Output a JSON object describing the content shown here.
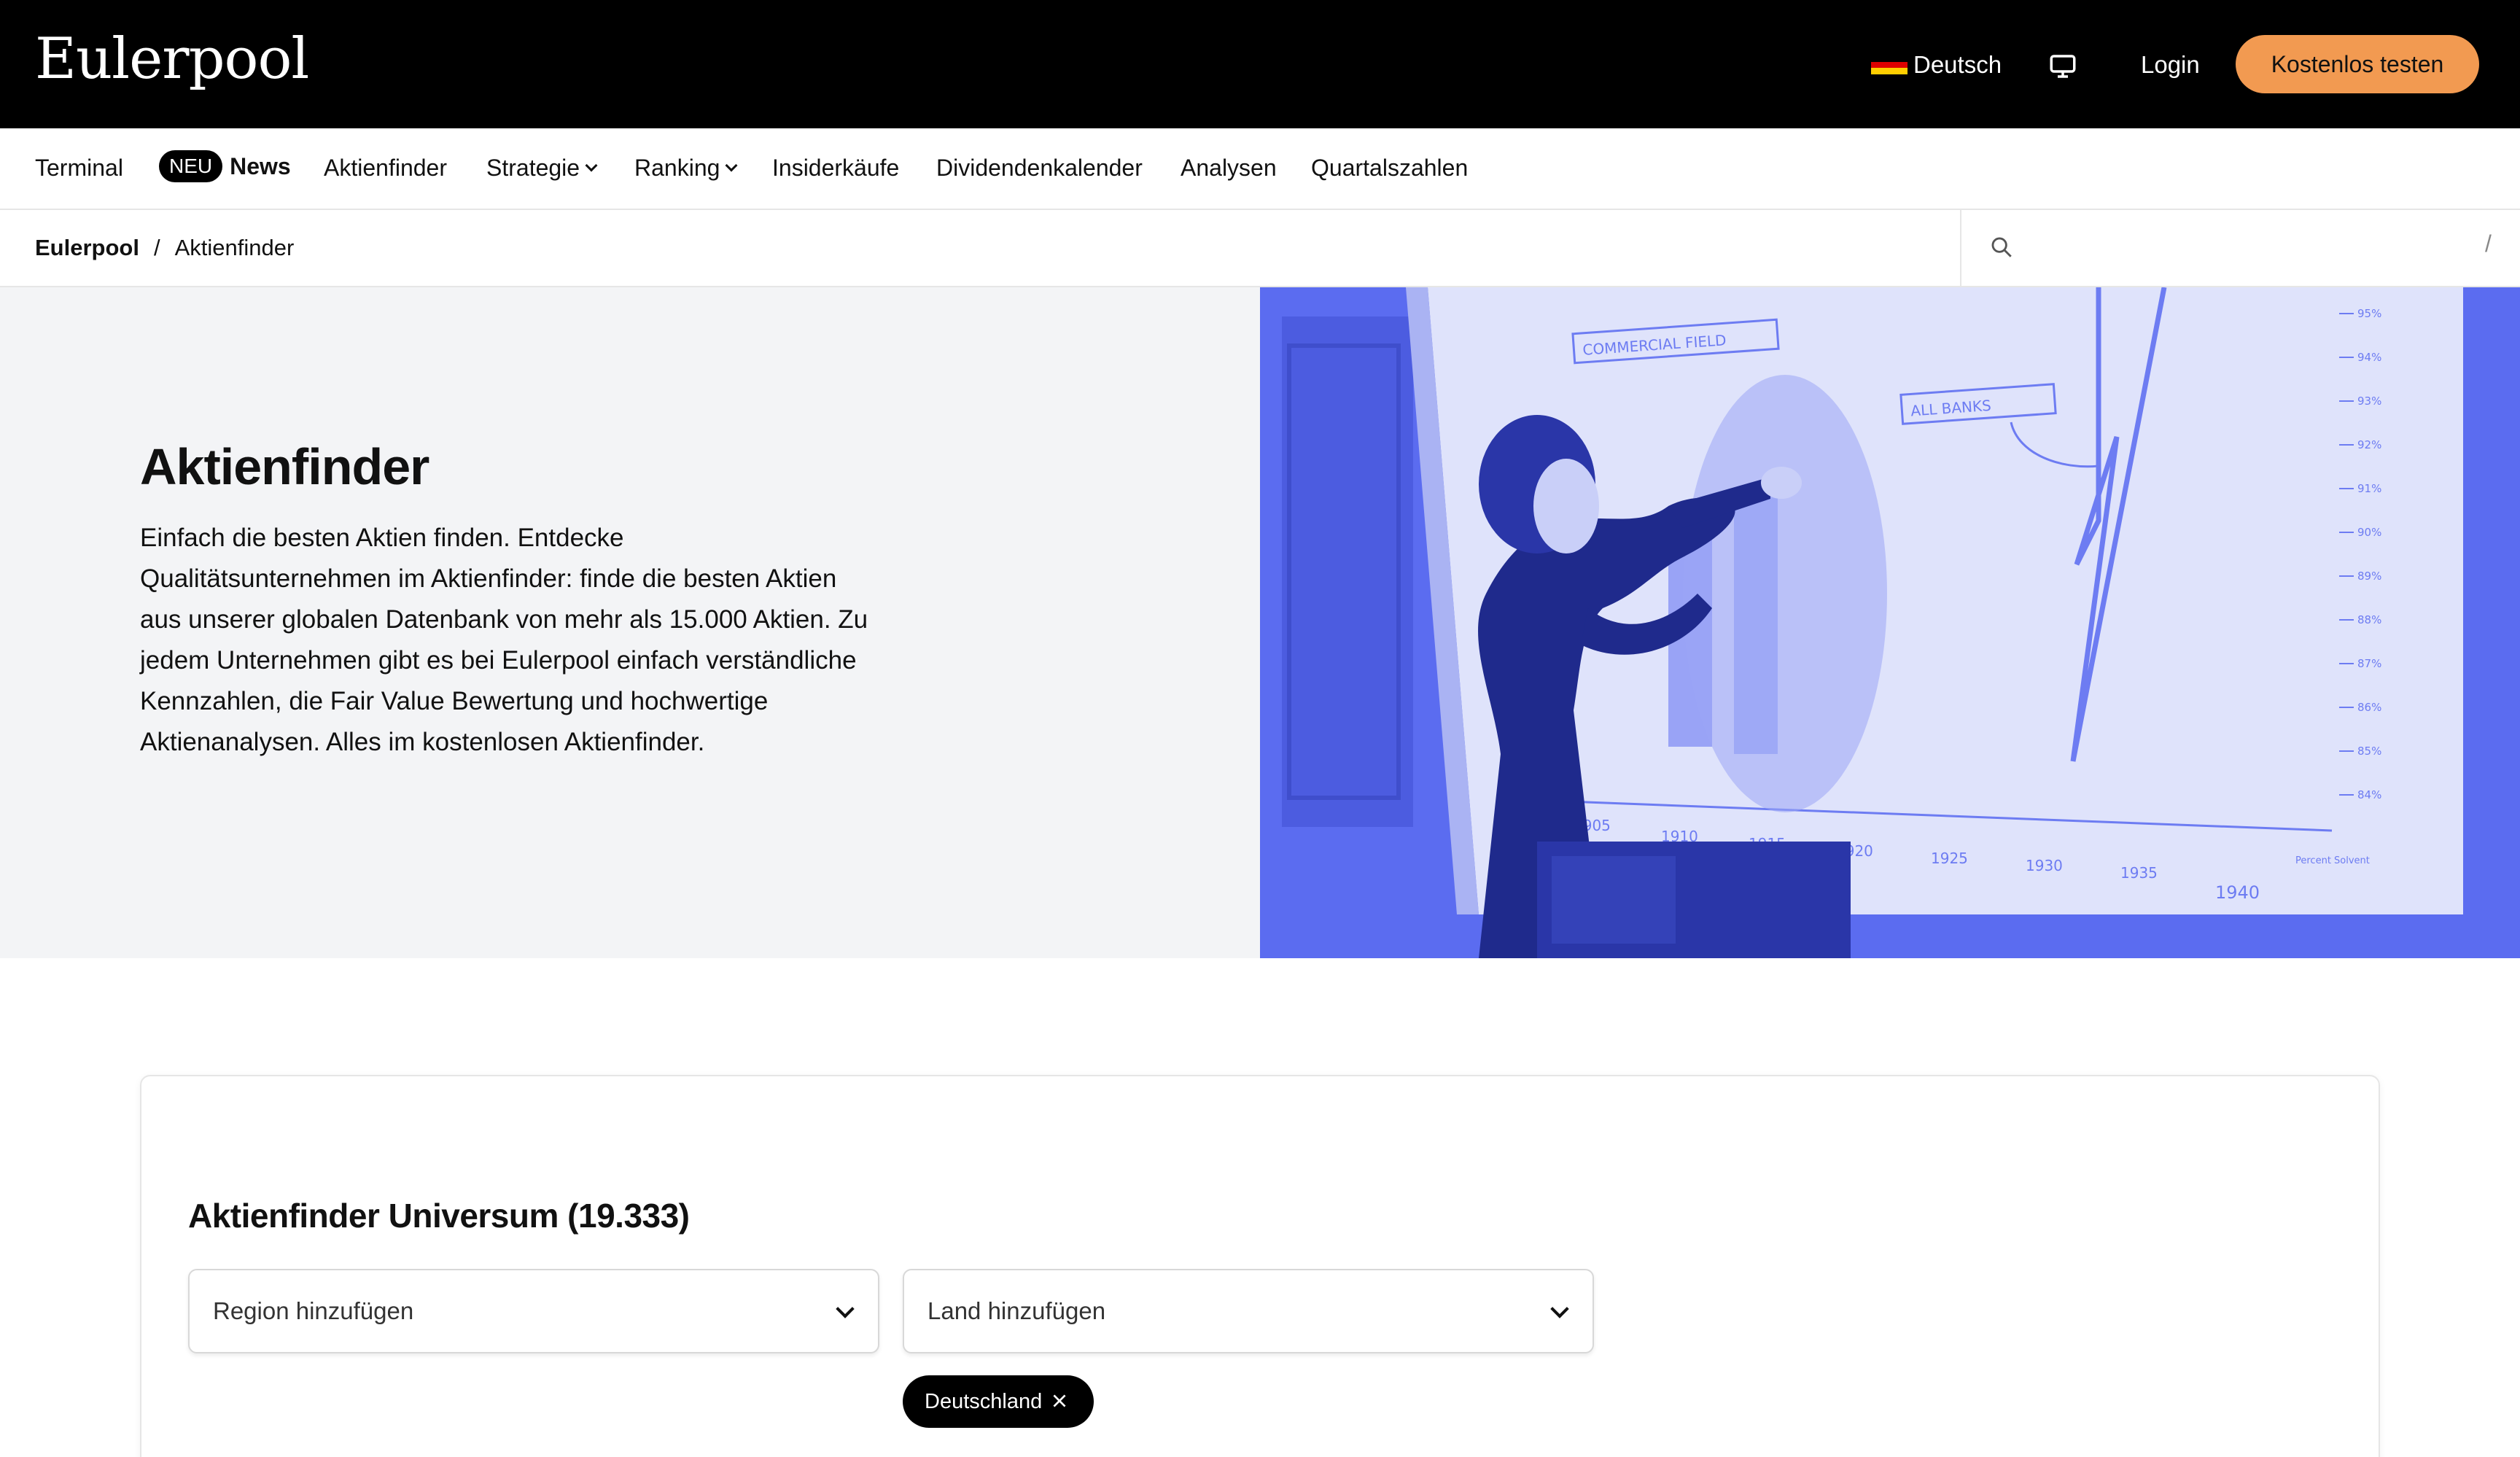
{
  "brand": {
    "logo_text": "Eulerpool"
  },
  "header": {
    "language_label": "Deutsch",
    "login_label": "Login",
    "cta_label": "Kostenlos testen",
    "cta_color": "#f29a51",
    "monitor_icon": "monitor-icon",
    "flag_icon": "germany-flag-icon"
  },
  "nav": {
    "items": [
      {
        "label": "Terminal"
      },
      {
        "label": "News",
        "badge": "NEU"
      },
      {
        "label": "Aktienfinder"
      },
      {
        "label": "Strategie",
        "dropdown": true
      },
      {
        "label": "Ranking",
        "dropdown": true
      },
      {
        "label": "Insiderkäufe"
      },
      {
        "label": "Dividendenkalender"
      },
      {
        "label": "Analysen"
      },
      {
        "label": "Quartalszahlen"
      }
    ]
  },
  "breadcrumb": {
    "home": "Eulerpool",
    "separator": "/",
    "current": "Aktienfinder"
  },
  "search": {
    "placeholder": "",
    "shortcut": "/"
  },
  "hero": {
    "title": "Aktienfinder",
    "text": "Einfach die besten Aktien finden. Entdecke Qualitätsunternehmen im Aktienfinder: finde die besten Aktien aus unserer globalen Datenbank von mehr als 15.000 Aktien. Zu jedem Unternehmen gibt es bei Eulerpool einfach verständliche Kennzahlen, die Fair Value Bewertung und hochwertige Aktienanalysen. Alles im kostenlosen Aktienfinder.",
    "image_tint": "#5b6cf0",
    "image_labels": {
      "chart_tag_1": "COMMERCIAL FIELD",
      "chart_tag_2": "ALL BANKS",
      "percent_ticks": [
        "95%",
        "94%",
        "93%",
        "92%",
        "91%",
        "90%",
        "89%",
        "88%",
        "87%",
        "86%",
        "85%",
        "84%"
      ],
      "year_ticks": [
        "1905",
        "1910",
        "1915",
        "1920",
        "1925",
        "1930",
        "1935",
        "1940"
      ],
      "axis_note": "Percent Solvent"
    }
  },
  "screener": {
    "title": "Aktienfinder Universum (19.333)",
    "region_placeholder": "Region hinzufügen",
    "country_placeholder": "Land hinzufügen",
    "selected_chip": "Deutschland"
  }
}
